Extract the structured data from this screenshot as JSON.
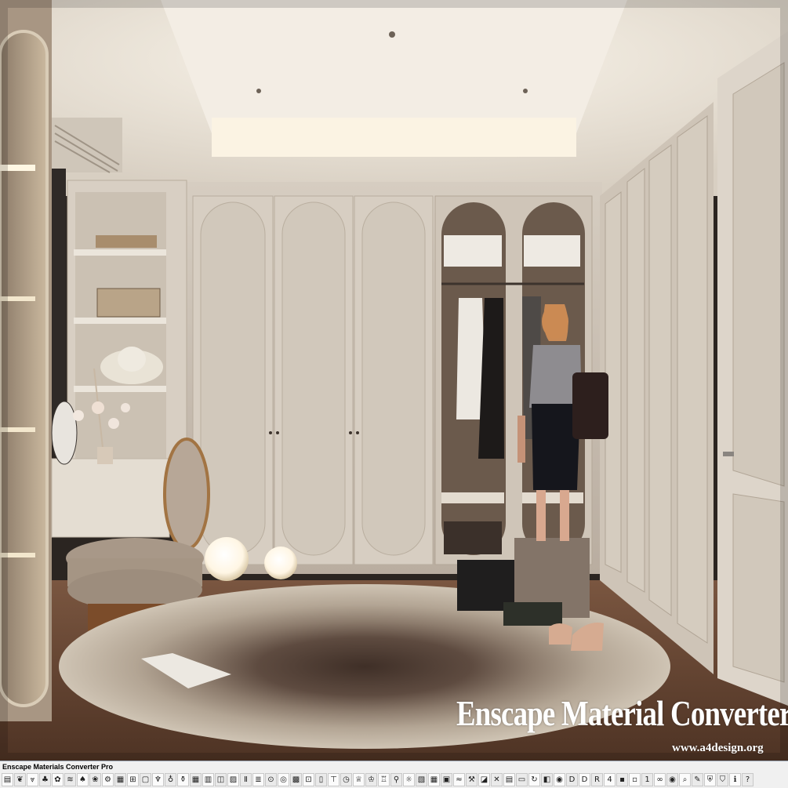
{
  "watermark": {
    "title": "Enscape Material Converter Pro",
    "url": "www.a4design.org"
  },
  "plugin_bar": {
    "title": "Enscape Materials Converter Pro",
    "tools": [
      {
        "name": "brick-icon",
        "glyph": "▤"
      },
      {
        "name": "leaf-icon",
        "glyph": "❦"
      },
      {
        "name": "grass-icon",
        "glyph": "⩔"
      },
      {
        "name": "plant-icon",
        "glyph": "♣"
      },
      {
        "name": "bush-icon",
        "glyph": "✿"
      },
      {
        "name": "wave-icon",
        "glyph": "≋"
      },
      {
        "name": "tree-icon",
        "glyph": "♠"
      },
      {
        "name": "flower-icon",
        "glyph": "❀"
      },
      {
        "name": "gear-icon",
        "glyph": "⚙"
      },
      {
        "name": "tile-icon",
        "glyph": "▦"
      },
      {
        "name": "window-icon",
        "glyph": "⊞"
      },
      {
        "name": "glass-icon",
        "glyph": "▢"
      },
      {
        "name": "wine-glass-icon",
        "glyph": "♆"
      },
      {
        "name": "lamp-icon",
        "glyph": "♁"
      },
      {
        "name": "bottle-icon",
        "glyph": "⚱"
      },
      {
        "name": "grid-icon",
        "glyph": "▦"
      },
      {
        "name": "brick-wall-icon",
        "glyph": "▥"
      },
      {
        "name": "stone-icon",
        "glyph": "◫"
      },
      {
        "name": "wood-icon",
        "glyph": "▨"
      },
      {
        "name": "column-icon",
        "glyph": "Ⅱ"
      },
      {
        "name": "fabric-icon",
        "glyph": "≣"
      },
      {
        "name": "car-icon",
        "glyph": "⊙"
      },
      {
        "name": "globe-icon",
        "glyph": "◎"
      },
      {
        "name": "texture-icon",
        "glyph": "▩"
      },
      {
        "name": "map-icon",
        "glyph": "⊡"
      },
      {
        "name": "door-icon",
        "glyph": "▯"
      },
      {
        "name": "shirt-icon",
        "glyph": "⊤"
      },
      {
        "name": "clock-icon",
        "glyph": "◷"
      },
      {
        "name": "trophy-icon",
        "glyph": "♕"
      },
      {
        "name": "trophy-gold-icon",
        "glyph": "♔"
      },
      {
        "name": "cup-icon",
        "glyph": "♖"
      },
      {
        "name": "vase-icon",
        "glyph": "⚲"
      },
      {
        "name": "light-icon",
        "glyph": "☼"
      },
      {
        "name": "metal-icon",
        "glyph": "▧"
      },
      {
        "name": "mesh-icon",
        "glyph": "▦"
      },
      {
        "name": "panel-icon",
        "glyph": "▣"
      },
      {
        "name": "water-icon",
        "glyph": "≈"
      },
      {
        "name": "tool-icon",
        "glyph": "⚒"
      },
      {
        "name": "marble-icon",
        "glyph": "◪"
      },
      {
        "name": "cross-icon",
        "glyph": "✕"
      },
      {
        "name": "image-icon",
        "glyph": "▤"
      },
      {
        "name": "folder-icon",
        "glyph": "▭"
      },
      {
        "name": "refresh-icon",
        "glyph": "↻"
      },
      {
        "name": "layers-icon",
        "glyph": "◧"
      },
      {
        "name": "coin-icon",
        "glyph": "◉"
      },
      {
        "name": "d-icon",
        "glyph": "D"
      },
      {
        "name": "color-d-icon",
        "glyph": "D"
      },
      {
        "name": "r80-icon",
        "glyph": "R"
      },
      {
        "name": "45-icon",
        "glyph": "4"
      },
      {
        "name": "save-icon",
        "glyph": "▪"
      },
      {
        "name": "save-as-icon",
        "glyph": "▫"
      },
      {
        "name": "one-to-one-icon",
        "glyph": "1"
      },
      {
        "name": "binoculars-icon",
        "glyph": "∞"
      },
      {
        "name": "eye-icon",
        "glyph": "◉"
      },
      {
        "name": "search-icon",
        "glyph": "⌕"
      },
      {
        "name": "brush-icon",
        "glyph": "✎"
      },
      {
        "name": "shield-icon",
        "glyph": "⛨"
      },
      {
        "name": "gold-shield-icon",
        "glyph": "⛉"
      },
      {
        "name": "info-icon",
        "glyph": "ℹ"
      },
      {
        "name": "help-icon",
        "glyph": "?"
      }
    ]
  },
  "colors": {
    "ceiling": "#ece7e0",
    "wall": "#d9d1c6",
    "cabinet": "#d4cbbf",
    "floor": "#6b4a36",
    "rug_outer": "#cfc5b7",
    "rug_inner": "#5a4a40",
    "toolbar_bg": "#f0f0f0"
  }
}
